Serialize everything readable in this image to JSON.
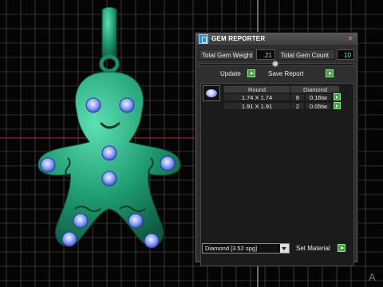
{
  "viewport": {
    "grid_color": "#8a8a8a",
    "axis_color": "#cc2222",
    "body_color": "#1fa67a",
    "gem_color": "#8fa6ff"
  },
  "panel": {
    "title": "GEM REPORTER",
    "close_glyph": "×",
    "total_weight_label": "Total Gem Weight",
    "total_weight_value": ".21",
    "total_count_label": "Total Gem Count",
    "total_count_value": "10",
    "update_label": "Update",
    "save_label": "Save Report",
    "table": {
      "headers": [
        "Round",
        "Diamond"
      ],
      "rows": [
        {
          "size": "1.74 X 1.74",
          "count": "8",
          "weight": "0.16tw"
        },
        {
          "size": "1.91 X 1.91",
          "count": "2",
          "weight": "0.05tw"
        }
      ]
    },
    "material_select": "Diamond    [3.52 spg]",
    "set_material_label": "Set Material"
  },
  "ghost_text": "A"
}
